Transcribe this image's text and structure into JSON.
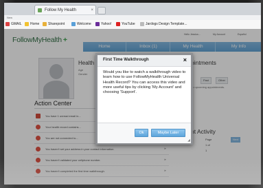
{
  "browser": {
    "tab_title": "Follow My Health",
    "tab_close": "×",
    "address_hint": "New"
  },
  "bookmarks": [
    {
      "label": "GMAIL",
      "icon": "gmail-icon"
    },
    {
      "label": "Home",
      "icon": "home-icon"
    },
    {
      "label": "Sharepoint",
      "icon": "sharepoint-icon"
    },
    {
      "label": "Welcome",
      "icon": "welcome-icon"
    },
    {
      "label": "Yahoo!",
      "icon": "yahoo-icon"
    },
    {
      "label": "YouTube",
      "icon": "youtube-icon"
    },
    {
      "label": "Jardogs Design Template...",
      "icon": "page-icon"
    }
  ],
  "site": {
    "logo": "FollowMyHealth",
    "logo_plus": "+",
    "utility": [
      "Hello Jessica...",
      "My Account",
      "Español"
    ],
    "nav": [
      "Home",
      "Inbox (1)",
      "My Health",
      "My Info"
    ]
  },
  "profile": {
    "title": "Health",
    "labels": [
      "Age",
      "Gender"
    ]
  },
  "action_center": {
    "title": "Action Center",
    "items": [
      "You have 1 unread email in...",
      "Your health record contains...",
      "You are not connected to...",
      "You haven't set your address in your contact information.",
      "You haven't validated your cellphone number.",
      "You haven't completed the first time walkthrough."
    ]
  },
  "appointments": {
    "title": "ointments",
    "tabs": [
      "Past",
      "Other"
    ],
    "empty_text": "no upcoming appointments."
  },
  "recent_activity": {
    "title": "nt Activity",
    "pager": [
      "Page 1 of 1",
      "Next"
    ]
  },
  "modal": {
    "title": "First Time Walkthrough",
    "close": "×",
    "body": "Would you like to watch a walkthrough video to learn how to use FollowMyHealth Universal Health Record? You can access this video and more useful tips by clicking 'My Account' and choosing 'Support'.",
    "ok_label": "Ok",
    "later_label": "Maybe Later"
  },
  "colors": {
    "nav_blue": "#5a9fd3",
    "brand_green": "#2b6b3f",
    "alert_red": "#e04c3c"
  }
}
